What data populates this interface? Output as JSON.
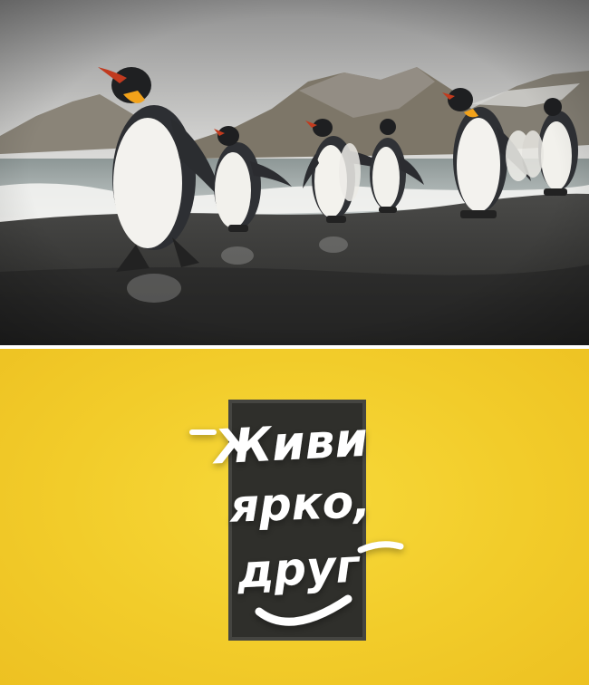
{
  "photo": {
    "subject": "penguins-on-beach"
  },
  "poster": {
    "background_color": "#f2cc2a",
    "frame_color": "#2f2f2b",
    "text_color": "#ffffff",
    "lines": [
      "Живи",
      "ярко,",
      "друг"
    ]
  }
}
